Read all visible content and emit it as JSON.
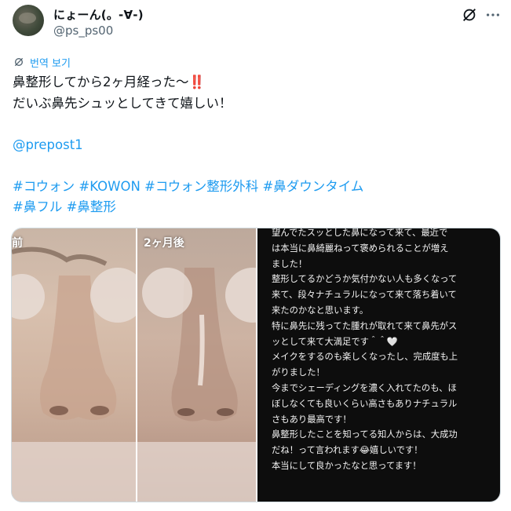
{
  "author": {
    "display_name": "にょーん(。-∀-)",
    "handle": "@ps_ps00"
  },
  "translate_label": "번역 보기",
  "tweet": {
    "lines": [
      "鼻整形してから2ヶ月経った〜",
      "だいぶ鼻先シュッとしてきて嬉しい！",
      "",
      "@prepost1",
      "",
      "#コウォン #KOWON #コウォン整形外科 #鼻ダウンタイム",
      "#鼻フル #鼻整形"
    ],
    "emoji_exclaim": "‼️"
  },
  "media": {
    "before_label": "前",
    "after_label": "2ヶ月後",
    "overlay_lines": [
      "望んでたスッとした鼻になって来て、最近で",
      "は本当に鼻綺麗ねって褒められることが増え",
      "ました！",
      "整形してるかどうか気付かない人も多くなって",
      "来て、段々ナチュラルになって来て落ち着いて",
      "来たのかなと思います。",
      "特に鼻先に残ってた腫れが取れて来て鼻先がス",
      "ッとして来て大満足です＾＾🤍",
      "メイクをするのも楽しくなったし、完成度も上",
      "がりました！",
      "今までシェーディングを濃く入れてたのも、ほ",
      "ぼしなくても良いくらい高さもありナチュラル",
      "さもあり最高です！",
      "鼻整形したことを知ってる知人からは、大成功",
      "だね！って言われます😂嬉しいです！",
      "本当にして良かったなと思ってます！"
    ]
  },
  "icons": [
    "grok-icon",
    "more-icon",
    "translate-icon"
  ],
  "colors": {
    "link": "#1d9bf0",
    "text": "#0f1419",
    "muted": "#536471"
  }
}
